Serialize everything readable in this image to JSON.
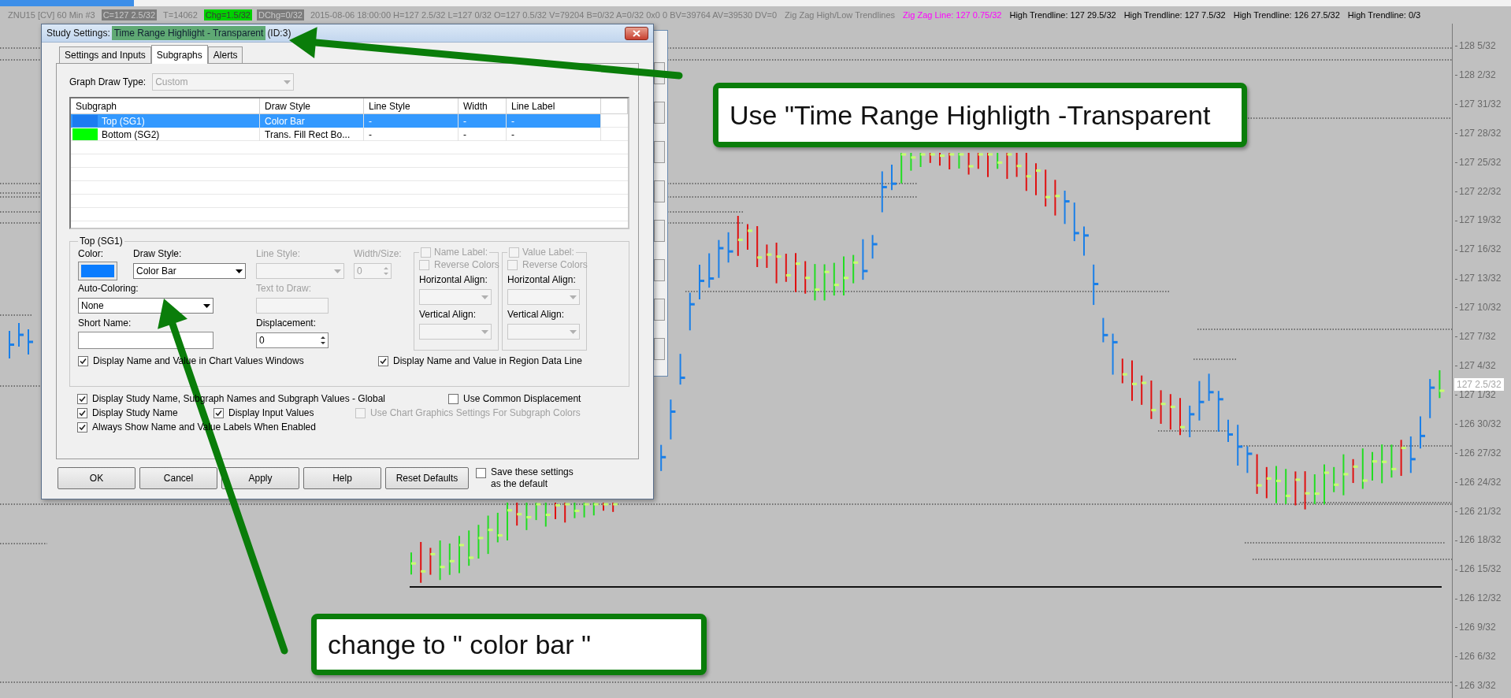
{
  "chart_header": {
    "segments": [
      {
        "text": "ZNU15 [CV]  60 Min  #3",
        "kind": "plain"
      },
      {
        "text": "C=127 2.5/32",
        "kind": "shaded"
      },
      {
        "text": "T=14062",
        "kind": "plain"
      },
      {
        "text": "Chg=1.5/32",
        "kind": "green"
      },
      {
        "text": "DChg=0/32",
        "kind": "shaded"
      },
      {
        "text": "2015-08-06 18:00:00 H=127 2.5/32 L=127 0/32 O=127 0.5/32 V=79204 B=0/32 A=0/32 0x0 0 BV=39764 AV=39530 DV=0",
        "kind": "plain"
      },
      {
        "text": "Zig Zag High/Low Trendlines",
        "kind": "plain"
      },
      {
        "text": "Zig Zag Line: 127 0.75/32",
        "kind": "magenta"
      },
      {
        "text": "High Trendline: 127 29.5/32",
        "kind": "dark"
      },
      {
        "text": "High Trendline: 127 7.5/32",
        "kind": "dark"
      },
      {
        "text": "High Trendline: 126 27.5/32",
        "kind": "dark"
      },
      {
        "text": "High Trendline: 0/3",
        "kind": "dark"
      }
    ]
  },
  "price_axis": {
    "labels": [
      "128 5/32",
      "128 2/32",
      "127 31/32",
      "127 28/32",
      "127 25/32",
      "127 22/32",
      "127 19/32",
      "127 16/32",
      "127 13/32",
      "127 10/32",
      "127 7/32",
      "127 4/32",
      "127 1/32",
      "126 30/32",
      "126 27/32",
      "126 24/32",
      "126 21/32",
      "126 18/32",
      "126 15/32",
      "126 12/32",
      "126 9/32",
      "126 6/32",
      "126 3/32"
    ],
    "current_price": "127 2.5/32"
  },
  "dialog": {
    "title_prefix": "Study Settings:",
    "title_highlight": "Time Range Highlight - Transparent",
    "title_suffix": "(ID:3)",
    "tabs": [
      {
        "label": "Settings and Inputs",
        "selected": false
      },
      {
        "label": "Subgraphs",
        "selected": true
      },
      {
        "label": "Alerts",
        "selected": false
      }
    ],
    "graph_draw_type": {
      "label": "Graph Draw Type:",
      "value": "Custom",
      "disabled": true
    },
    "subgraph_table": {
      "columns": [
        "Subgraph",
        "Draw Style",
        "Line Style",
        "Width",
        "Line Label"
      ],
      "rows": [
        {
          "color": "#1c7cf0",
          "cells": [
            "Top (SG1)",
            "Color Bar",
            "-",
            "-",
            "-"
          ],
          "selected": true
        },
        {
          "color": "#00ff00",
          "cells": [
            "Bottom (SG2)",
            "Trans. Fill Rect Bo...",
            "-",
            "-",
            "-"
          ],
          "selected": false
        }
      ]
    },
    "group": {
      "title": "Top (SG1)",
      "color_label": "Color:",
      "color": "#0a7cff",
      "draw_style": {
        "label": "Draw Style:",
        "value": "Color Bar",
        "disabled": false
      },
      "line_style": {
        "label": "Line Style:",
        "disabled": true
      },
      "width_size": {
        "label": "Width/Size:",
        "value": "0",
        "disabled": true
      },
      "auto_coloring": {
        "label": "Auto-Coloring:",
        "value": "None",
        "disabled": false
      },
      "text_to_draw": {
        "label": "Text to Draw:",
        "disabled": true
      },
      "short_name": {
        "label": "Short Name:"
      },
      "displacement": {
        "label": "Displacement:",
        "value": "0"
      },
      "label_boxes": [
        {
          "title": "Name Label:",
          "checked": false,
          "disabled": true,
          "reverse": {
            "label": "Reverse Colors",
            "checked": false,
            "disabled": true
          },
          "horizontal_align": "Horizontal Align:",
          "vertical_align": "Vertical Align:"
        },
        {
          "title": "Value Label:",
          "checked": false,
          "disabled": true,
          "reverse": {
            "label": "Reverse Colors",
            "checked": false,
            "disabled": true
          },
          "horizontal_align": "Horizontal Align:",
          "vertical_align": "Vertical Align:"
        }
      ],
      "checks": [
        {
          "label": "Display Name and Value in Chart Values Windows",
          "checked": true
        },
        {
          "label": "Display Name and Value in Region Data Line",
          "checked": true
        }
      ]
    },
    "options": [
      {
        "label": "Display Study Name, Subgraph Names and Subgraph Values - Global",
        "checked": true,
        "disabled": false
      },
      {
        "label": "Use Common Displacement",
        "checked": false,
        "disabled": false
      },
      {
        "label": "Display Study Name",
        "checked": true,
        "disabled": false
      },
      {
        "label": "Display Input Values",
        "checked": true,
        "disabled": false
      },
      {
        "label": "Use Chart Graphics Settings For Subgraph Colors",
        "checked": false,
        "disabled": true
      },
      {
        "label": "Always Show Name and Value Labels When Enabled",
        "checked": true,
        "disabled": false
      }
    ],
    "buttons": [
      "OK",
      "Cancel",
      "Apply",
      "Help",
      "Reset Defaults"
    ],
    "save_default": {
      "label": "Save these settings as the default",
      "checked": false
    }
  },
  "callouts": [
    "Use \"Time Range Highligth -Transparent",
    "change to \" color bar \""
  ]
}
